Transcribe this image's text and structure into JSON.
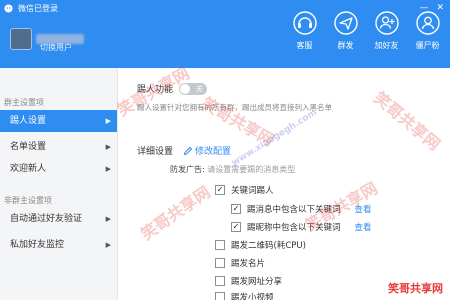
{
  "header": {
    "app_title": "微信已登录",
    "switch_user": "切换用户",
    "window_controls": [
      "—",
      "✕"
    ],
    "toolbar": [
      {
        "label": "客服",
        "icon": "customer-service-icon"
      },
      {
        "label": "群发",
        "icon": "broadcast-icon"
      },
      {
        "label": "加好友",
        "icon": "add-friend-icon"
      },
      {
        "label": "僵尸粉",
        "icon": "zombie-fans-icon"
      }
    ],
    "color": "#2f8cf0"
  },
  "sidebar": {
    "group1": "群主设置项",
    "items1": [
      {
        "label": "踢人设置",
        "arrow": "▶",
        "active": true
      },
      {
        "label": "名单设置",
        "arrow": "▶",
        "active": false
      },
      {
        "label": "欢迎新人",
        "arrow": "▶",
        "active": false
      }
    ],
    "group2": "非群主设置项",
    "items2": [
      {
        "label": "自动通过好友验证",
        "arrow": "▶",
        "active": false
      },
      {
        "label": "私加好友监控",
        "arrow": "▶",
        "active": false
      }
    ]
  },
  "main": {
    "kick_label": "踢人功能",
    "toggle_label": "关",
    "kick_desc": "踢人设置针对您拥有的所有群，踢出成员将直接列入黑名单",
    "detail_label": "详细设置",
    "edit_config": "修改配置",
    "ad_label": "防发广告:",
    "ad_hint": "请设置需要踢的消息类型",
    "options": [
      {
        "label": "关键词踢人",
        "checked": true
      },
      {
        "label": "踢消息中包含以下关键词",
        "checked": true,
        "link": "查看"
      },
      {
        "label": "踢昵称中包含以下关键词",
        "checked": true,
        "link": "查看"
      },
      {
        "label": "踢发二维码(耗CPU)",
        "checked": false
      },
      {
        "label": "踢发名片",
        "checked": false
      },
      {
        "label": "踢发网址分享",
        "checked": false
      },
      {
        "label": "踢发小视频",
        "checked": false
      }
    ]
  },
  "watermark": {
    "text": "笑哥共享网",
    "url": "www.xiaogegh.com",
    "corner": "笑哥共享网"
  }
}
